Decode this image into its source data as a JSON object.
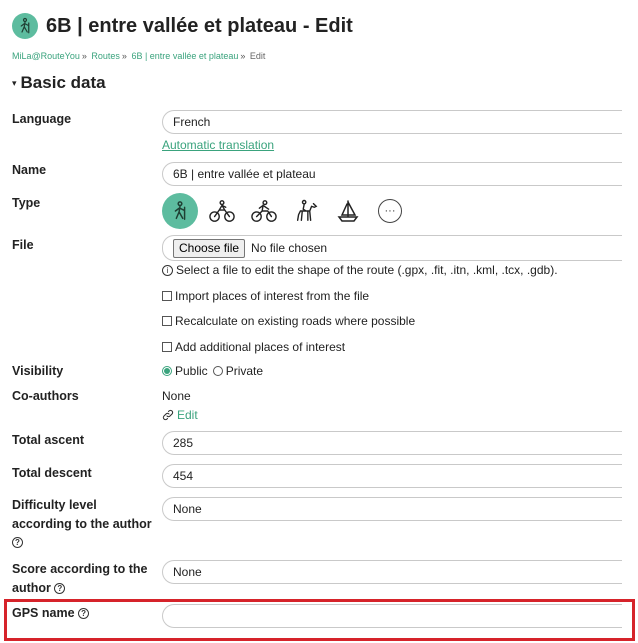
{
  "header": {
    "title": "6B | entre vallée et plateau - Edit",
    "icon": "hiker-icon"
  },
  "breadcrumb": {
    "items": [
      "MiLa@RouteYou",
      "Routes",
      "6B | entre vallée et plateau"
    ],
    "current": "Edit",
    "separator": "»"
  },
  "section": {
    "caret": "▾",
    "title": "Basic data"
  },
  "fields": {
    "language": {
      "label": "Language",
      "value": "French",
      "link": "Automatic translation"
    },
    "name": {
      "label": "Name",
      "value": "6B | entre vallée et plateau"
    },
    "type": {
      "label": "Type",
      "options": [
        "walking",
        "cycling",
        "mountain-biking",
        "horse-riding",
        "sailing",
        "more"
      ],
      "selected": "walking",
      "more_glyph": "···"
    },
    "file": {
      "label": "File",
      "button": "Choose file",
      "status": "No file chosen",
      "info_glyph": "i",
      "hint": "Select a file to edit the shape of the route (.gpx, .fit, .itn, .kml, .tcx, .gdb).",
      "options": [
        "Import places of interest from the file",
        "Recalculate on existing roads where possible",
        "Add additional places of interest"
      ]
    },
    "visibility": {
      "label": "Visibility",
      "options": [
        "Public",
        "Private"
      ],
      "selected": "Public"
    },
    "coauthors": {
      "label": "Co-authors",
      "value": "None",
      "edit": "Edit"
    },
    "total_ascent": {
      "label": "Total ascent",
      "value": "285"
    },
    "total_descent": {
      "label": "Total descent",
      "value": "454"
    },
    "difficulty": {
      "label_line1": "Difficulty level",
      "label_line2": "according to the author",
      "value": "None",
      "help_glyph": "?"
    },
    "score": {
      "label_line1": "Score according to the",
      "label_line2": "author",
      "value": "None",
      "help_glyph": "?"
    },
    "gps_name": {
      "label": "GPS name",
      "value": "",
      "help_glyph": "?"
    }
  },
  "colors": {
    "accent": "#3aa37d",
    "icon_bg": "#5dbc9f",
    "highlight": "#d6232a"
  }
}
